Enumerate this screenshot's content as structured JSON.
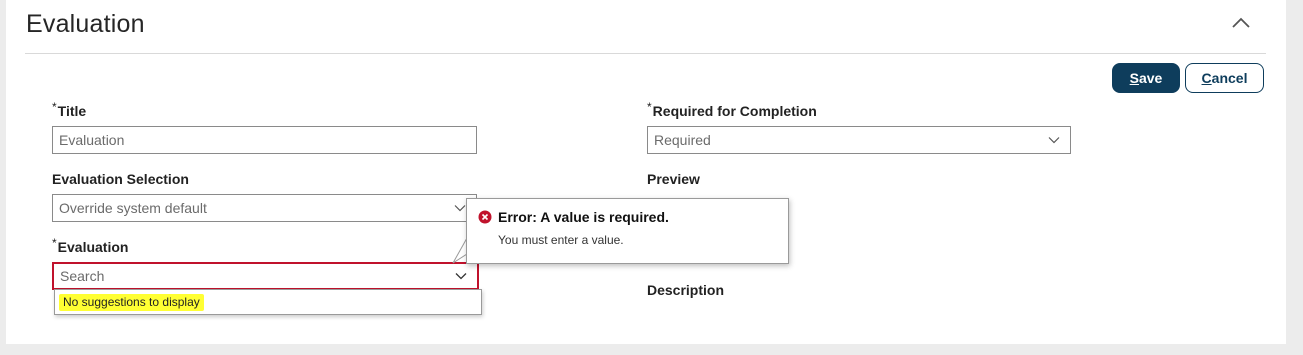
{
  "section": {
    "title": "Evaluation",
    "collapse_icon": "chevron-up-icon"
  },
  "toolbar": {
    "save_label_accel": "S",
    "save_label_rest": "ave",
    "cancel_label_accel": "C",
    "cancel_label_rest": "ancel"
  },
  "form": {
    "required_marker": "*",
    "title": {
      "label": "Title",
      "value": "Evaluation"
    },
    "required_for_completion": {
      "label": "Required for Completion",
      "value": "Required"
    },
    "evaluation_selection": {
      "label": "Evaluation Selection",
      "value": "Override system default"
    },
    "preview": {
      "label": "Preview"
    },
    "evaluation": {
      "label": "Evaluation",
      "placeholder": "Search",
      "suggestion_message": "No suggestions to display"
    },
    "description": {
      "label": "Description"
    }
  },
  "error_tooltip": {
    "title": "Error: A value is required.",
    "body": "You must enter a value.",
    "icon": "error-circle-icon",
    "color": "#c0122c"
  },
  "colors": {
    "primary": "#0e3d5c",
    "error": "#c0122c",
    "highlight": "#ffff33"
  }
}
